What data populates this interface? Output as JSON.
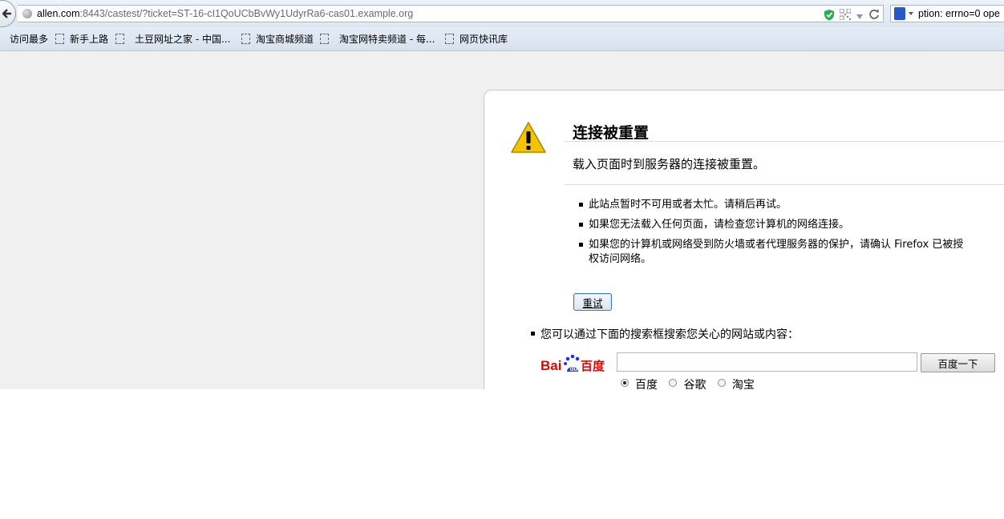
{
  "address_bar": {
    "url_host": "allen.com",
    "url_rest": ":8443/castest/?ticket=ST-16-cI1QoUCbBvWy1UdyrRa6-cas01.example.org"
  },
  "search_bar": {
    "text": "ption: errno=0 ope"
  },
  "bookmarks": [
    {
      "label": "访问最多"
    },
    {
      "label": "新手上路"
    },
    {
      "label": "土豆网址之家 - 中国..."
    },
    {
      "label": "淘宝商城频道"
    },
    {
      "label": "淘宝网特卖频道 - 每..."
    },
    {
      "label": "网页快讯库"
    }
  ],
  "error_page": {
    "title": "连接被重置",
    "subtitle": "载入页面时到服务器的连接被重置。",
    "suggestions": [
      "此站点暂时不可用或者太忙。请稍后再试。",
      "如果您无法载入任何页面，请检查您计算机的网络连接。",
      "如果您的计算机或网络受到防火墙或者代理服务器的保护，请确认 Firefox 已被授权访问网络。"
    ],
    "retry_label": "重试",
    "search_hint": "您可以通过下面的搜索框搜索您关心的网站或内容：",
    "search_button_label": "百度一下",
    "search_value": "",
    "engines": [
      {
        "label": "百度",
        "selected": true
      },
      {
        "label": "谷歌",
        "selected": false
      },
      {
        "label": "淘宝",
        "selected": false
      }
    ]
  },
  "colors": {
    "baidu_red": "#e10602",
    "baidu_blue": "#2932e1",
    "warning_yellow": "#f5c400"
  }
}
